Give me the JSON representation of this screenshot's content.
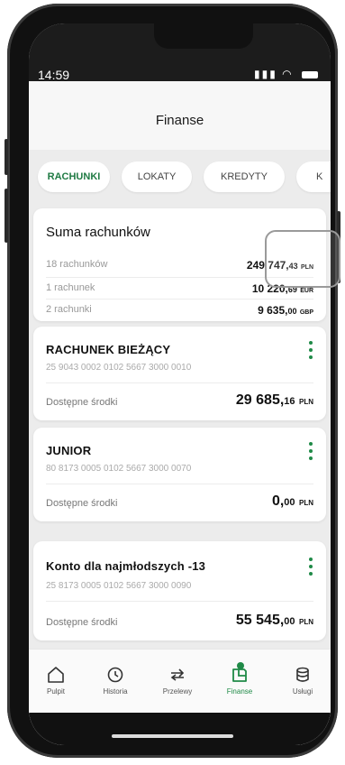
{
  "status": {
    "time": "14:59"
  },
  "header": {
    "title": "Finanse"
  },
  "tabs": [
    {
      "label": "RACHUNKI",
      "active": true
    },
    {
      "label": "LOKATY",
      "active": false
    },
    {
      "label": "KREDYTY",
      "active": false
    },
    {
      "label": "K",
      "active": false
    }
  ],
  "summary": {
    "title": "Suma rachunków",
    "rows": [
      {
        "label": "18 rachunków",
        "amount": "249 747,",
        "decimals": "43",
        "currency": "PLN"
      },
      {
        "label": "1 rachunek",
        "amount": "10 220,",
        "decimals": "69",
        "currency": "EUR"
      },
      {
        "label": "2 rachunki",
        "amount": "9 635,",
        "decimals": "00",
        "currency": "GBP"
      }
    ]
  },
  "accounts": [
    {
      "name": "RACHUNEK BIEŻĄCY",
      "number": "25 9043 0002 0102 5667 3000 0010",
      "avail_label": "Dostępne środki",
      "amount": "29 685,",
      "decimals": "16",
      "currency": "PLN"
    },
    {
      "name": "JUNIOR",
      "number": "80 8173 0005 0102 5667 3000 0070",
      "avail_label": "Dostępne środki",
      "amount": "0,",
      "decimals": "00",
      "currency": "PLN"
    },
    {
      "name": "Konto dla najmłodszych -13",
      "number": "25 8173 0005 0102 5667 3000 0090",
      "avail_label": "Dostępne środki",
      "amount": "55 545,",
      "decimals": "00",
      "currency": "PLN"
    }
  ],
  "nav": [
    {
      "label": "Pulpit",
      "icon": "home-icon"
    },
    {
      "label": "Historia",
      "icon": "history-icon"
    },
    {
      "label": "Przelewy",
      "icon": "transfer-icon"
    },
    {
      "label": "Finanse",
      "icon": "wallet-icon",
      "active": true
    },
    {
      "label": "Usługi",
      "icon": "database-icon"
    }
  ],
  "colors": {
    "accent": "#1f8a47",
    "background": "#ececec"
  }
}
